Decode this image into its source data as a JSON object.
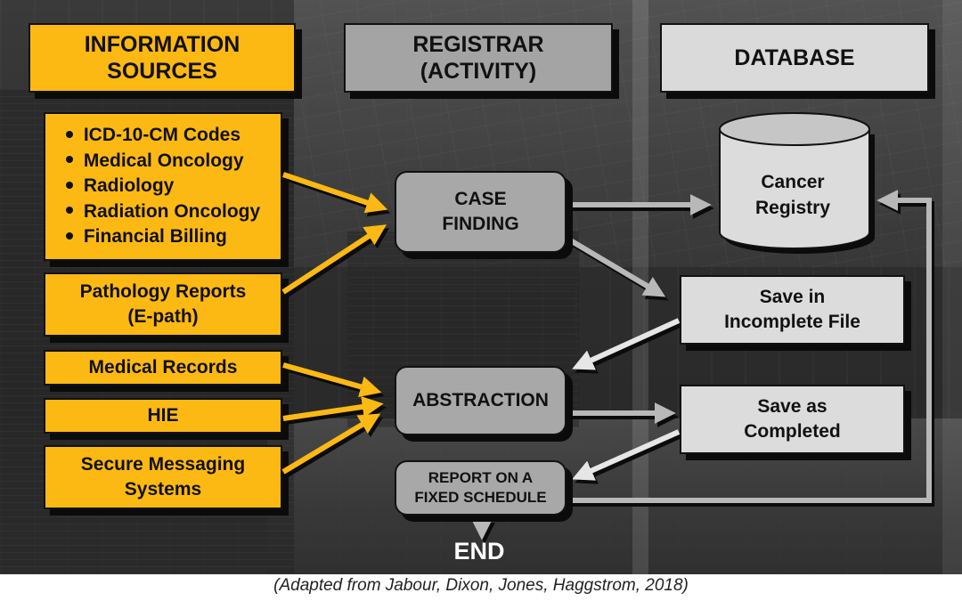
{
  "columns": {
    "information_sources": "INFORMATION SOURCES",
    "information_sources_lines": [
      "INFORMATION",
      "SOURCES"
    ],
    "registrar_lines": [
      "REGISTRAR",
      "(ACTIVITY)"
    ],
    "database": "DATABASE"
  },
  "sources": {
    "bulleted_list": [
      "ICD-10-CM Codes",
      "Medical Oncology",
      "Radiology",
      "Radiation Oncology",
      "Financial Billing"
    ],
    "pathology_lines": [
      "Pathology Reports",
      "(E-path)"
    ],
    "medical_records": "Medical Records",
    "hie": "HIE",
    "secure_messaging_lines": [
      "Secure Messaging",
      "Systems"
    ]
  },
  "activities": {
    "case_finding_lines": [
      "CASE",
      "FINDING"
    ],
    "abstraction": "ABSTRACTION",
    "report_lines": [
      "REPORT ON A",
      "FIXED SCHEDULE"
    ]
  },
  "database": {
    "registry_lines": [
      "Cancer",
      "Registry"
    ],
    "incomplete_lines": [
      "Save in",
      "Incomplete File"
    ],
    "completed_lines": [
      "Save as",
      "Completed"
    ]
  },
  "end_label": "END",
  "caption": "(Adapted from Jabour, Dixon, Jones, Haggstrom, 2018)",
  "colors": {
    "source_yellow": "#fdb913",
    "activity_gray": "#a8a8a8",
    "database_light": "#dcdcdc",
    "arrow_yellow": "#fdb913",
    "arrow_gray": "#b8b8b8",
    "arrow_light": "#e6e6e6"
  }
}
